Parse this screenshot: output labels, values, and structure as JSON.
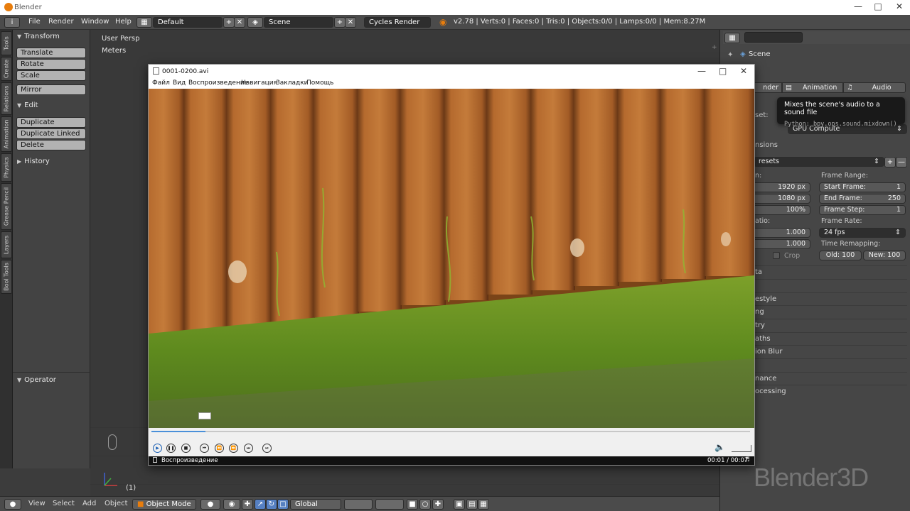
{
  "window": {
    "title": "Blender"
  },
  "header": {
    "menus": [
      "File",
      "Render",
      "Window",
      "Help"
    ],
    "screen_layout": "Default",
    "scene": "Scene",
    "render_engine": "Cycles Render",
    "stats": "v2.78 | Verts:0 | Faces:0 | Tris:0 | Objects:0/0 | Lamps:0/0 | Mem:8.27M"
  },
  "tabs": [
    "Tools",
    "Create",
    "Relations",
    "Animation",
    "Physics",
    "Grease Pencil",
    "Layers",
    "Bool Tools"
  ],
  "tool_shelf": {
    "transform": {
      "title": "Transform",
      "buttons": [
        "Translate",
        "Rotate",
        "Scale",
        "Mirror"
      ]
    },
    "edit": {
      "title": "Edit",
      "buttons": [
        "Duplicate",
        "Duplicate Linked",
        "Delete"
      ]
    },
    "history": {
      "title": "History"
    },
    "operator": {
      "title": "Operator"
    }
  },
  "viewport": {
    "view_name": "User Persp",
    "units": "Meters",
    "frame": "(1)"
  },
  "properties": {
    "context": "Scene",
    "tabs": [
      "nder",
      "Animation",
      "Audio"
    ],
    "set_label": "set:",
    "device": "GPU Compute",
    "dimensions": "nsions",
    "presets": "resets",
    "resolution_label": "n:",
    "res_x": "1920 px",
    "res_y": "1080 px",
    "res_pct": "100%",
    "aspect_label": "atio:",
    "aspect_x": "1.000",
    "aspect_y": "1.000",
    "crop": "Crop",
    "frame_range": {
      "title": "Frame Range:",
      "start_label": "Start Frame:",
      "start": "1",
      "end_label": "End Frame:",
      "end": "250",
      "step_label": "Frame Step:",
      "step": "1"
    },
    "frame_rate": {
      "title": "Frame Rate:",
      "value": "24 fps"
    },
    "time_remap": {
      "title": "Time Remapping:",
      "old": "Old: 100",
      "new": "New: 100"
    },
    "sections": [
      "ta",
      "estyle",
      "ng",
      "try",
      "aths",
      "ion Blur",
      "nance",
      "ocessing"
    ]
  },
  "tooltip": {
    "text": "Mixes the scene's audio to a sound file",
    "python": "Python: bpy.ops.sound.mixdown()"
  },
  "bottom_header": {
    "menus": [
      "View",
      "Select",
      "Add",
      "Object"
    ],
    "mode": "Object Mode",
    "orientation": "Global"
  },
  "player": {
    "title": "0001-0200.avi",
    "menus": [
      "Файл",
      "Вид",
      "Воспроизведение",
      "Навигация",
      "Закладки",
      "Помощь"
    ],
    "status": "Воспроизведение",
    "time": "00:01 / 00:07",
    "progress_fraction": 0.09
  },
  "watermark": "Blender3D"
}
